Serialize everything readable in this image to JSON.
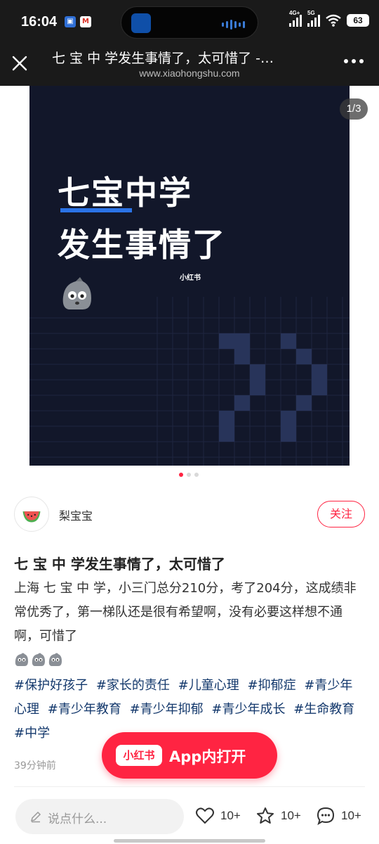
{
  "status_bar": {
    "time": "16:04",
    "app_icons": [
      "M"
    ],
    "network_labels": [
      "4G+",
      "5G"
    ],
    "battery": "63"
  },
  "title_bar": {
    "title": "七 宝 中 学发生事情了，太可惜了 -…",
    "url": "www.xiaohongshu.com"
  },
  "carousel": {
    "page_indicator": "1/3",
    "slide_line1": "七宝中学",
    "slide_line2": "发生事情了",
    "watermark": "小红书",
    "total_slides": 3,
    "active_slide": 1
  },
  "author": {
    "name": "梨宝宝",
    "follow_label": "关注"
  },
  "note": {
    "title": "七 宝 中 学发生事情了，太可惜了",
    "body": "上海 七 宝 中 学，小三门总分210分，考了204分，这成绩非常优秀了，第一梯队还是很有希望啊，没有必要这样想不通啊，可惜了",
    "tags": [
      "#保护好孩子",
      "#家长的责任",
      "#儿童心理",
      "#抑郁症",
      "#青少年心理",
      "#青少年教育",
      "#青少年抑郁",
      "#青少年成长",
      "#生命教育",
      "#中学"
    ],
    "time": "39分钟前"
  },
  "open_app": {
    "logo": "小红书",
    "label": "App内打开"
  },
  "bottom_bar": {
    "comment_placeholder": "说点什么...",
    "like_count": "10+",
    "collect_count": "10+",
    "comment_count": "10+"
  },
  "colors": {
    "brand_red": "#ff2442",
    "tag_blue": "#13386c",
    "slide_bg": "#12172a",
    "underline_blue": "#2b73e6"
  }
}
